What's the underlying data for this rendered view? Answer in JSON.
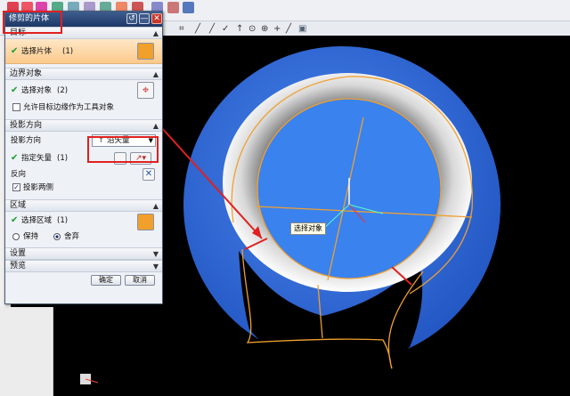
{
  "dialog": {
    "title": "修剪的片体",
    "btn_back": "↺",
    "btn_min": "—",
    "btn_close": "✕",
    "sections": {
      "target": {
        "label": "目标"
      },
      "boundary": {
        "label": "边界对象"
      },
      "projection": {
        "label": "投影方向"
      },
      "region": {
        "label": "区域"
      },
      "settings": {
        "label": "设置"
      },
      "preview": {
        "label": "预览"
      }
    },
    "target_select": {
      "label": "选择片体",
      "count": "(1)"
    },
    "boundary_select": {
      "label": "选择对象",
      "count": "(2)"
    },
    "allow_edge_tool": {
      "label": "允许目标边缘作为工具对象",
      "checked": false
    },
    "projection_dir_label": "投影方向",
    "projection_dropdown": {
      "icon": "↑",
      "value": "沿矢量"
    },
    "specify_vector": {
      "label": "指定矢量",
      "count": "(1)"
    },
    "reverse_label": "反向",
    "project_both": {
      "label": "投影两侧",
      "checked": true
    },
    "region_select": {
      "label": "选择区域",
      "count": "(1)"
    },
    "keep_label": "保持",
    "discard_label": "舍弃",
    "region_mode": "舍弃",
    "ok_label": "确定",
    "cancel_label": "取消"
  },
  "viewport": {
    "tooltip": "选择对象",
    "background": "#000000",
    "sphere_color": "#2f6fe0",
    "inner_face_color": "#3a82ee",
    "highlight_edge_color": "#f0a030",
    "annotation_color": "#e02020"
  },
  "toolbar_icons": [
    "sketch-icon",
    "snap-icon",
    "curve-icon",
    "line-icon",
    "arc-icon",
    "point-icon",
    "vector-icon",
    "plane-icon",
    "cube-icon"
  ]
}
